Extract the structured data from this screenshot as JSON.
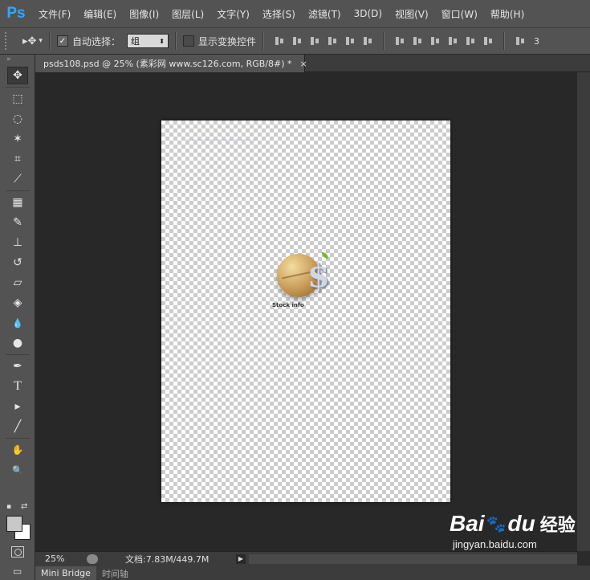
{
  "app": {
    "logo": "Ps"
  },
  "menubar": {
    "items": [
      "文件(F)",
      "编辑(E)",
      "图像(I)",
      "图层(L)",
      "文字(Y)",
      "选择(S)",
      "滤镜(T)",
      "3D(D)",
      "视图(V)",
      "窗口(W)",
      "帮助(H)"
    ]
  },
  "options": {
    "tool_symbol": "▸✥",
    "tool_dropdown": "▾",
    "auto_select_label": "自动选择：",
    "auto_select_checked": true,
    "auto_select_value": "组",
    "show_transform_label": "显示变换控件",
    "show_transform_checked": false,
    "tail_text": "3"
  },
  "document": {
    "tab_title": "psds108.psd @ 25% (素彩网 www.sc126.com, RGB/8#) *",
    "close_symbol": "×",
    "canvas_caption": "Stock info"
  },
  "toolbox": {
    "collapse_symbol": "»",
    "tools": [
      {
        "name": "move-tool",
        "glyph": "✥",
        "active": true
      },
      {
        "name": "marquee-tool",
        "glyph": "⬚"
      },
      {
        "name": "lasso-tool",
        "glyph": "◌"
      },
      {
        "name": "magic-wand-tool",
        "glyph": "✶"
      },
      {
        "name": "crop-tool",
        "glyph": "⌗"
      },
      {
        "name": "eyedropper-tool",
        "glyph": "⟋"
      },
      {
        "name": "healing-brush-tool",
        "glyph": "▦"
      },
      {
        "name": "brush-tool",
        "glyph": "✎"
      },
      {
        "name": "clone-stamp-tool",
        "glyph": "⊥"
      },
      {
        "name": "history-brush-tool",
        "glyph": "↺"
      },
      {
        "name": "eraser-tool",
        "glyph": "▱"
      },
      {
        "name": "paint-bucket-tool",
        "glyph": "◈"
      },
      {
        "name": "blur-tool",
        "glyph": "💧"
      },
      {
        "name": "dodge-tool",
        "glyph": "●"
      },
      {
        "name": "pen-tool",
        "glyph": "✒"
      },
      {
        "name": "type-tool",
        "glyph": "T"
      },
      {
        "name": "path-selection-tool",
        "glyph": "▸"
      },
      {
        "name": "line-tool",
        "glyph": "╱"
      },
      {
        "name": "hand-tool",
        "glyph": "✋"
      },
      {
        "name": "zoom-tool",
        "glyph": "🔍"
      }
    ],
    "swap_symbol": "⇄",
    "default_colors_symbol": "▪",
    "screen_mode_symbol": "▭",
    "foreground_color": "#c8c8c8",
    "background_color": "#ffffff"
  },
  "status": {
    "zoom": "25%",
    "doc_info": "文档:7.83M/449.7M",
    "arrow": "▶"
  },
  "bottom_panel": {
    "tabs": [
      "Mini Bridge",
      "时间轴"
    ]
  },
  "watermark": {
    "bai": "Bai",
    "paw": "🐾",
    "du": "du",
    "jingyan": "经验",
    "url": "jingyan.baidu.com"
  }
}
